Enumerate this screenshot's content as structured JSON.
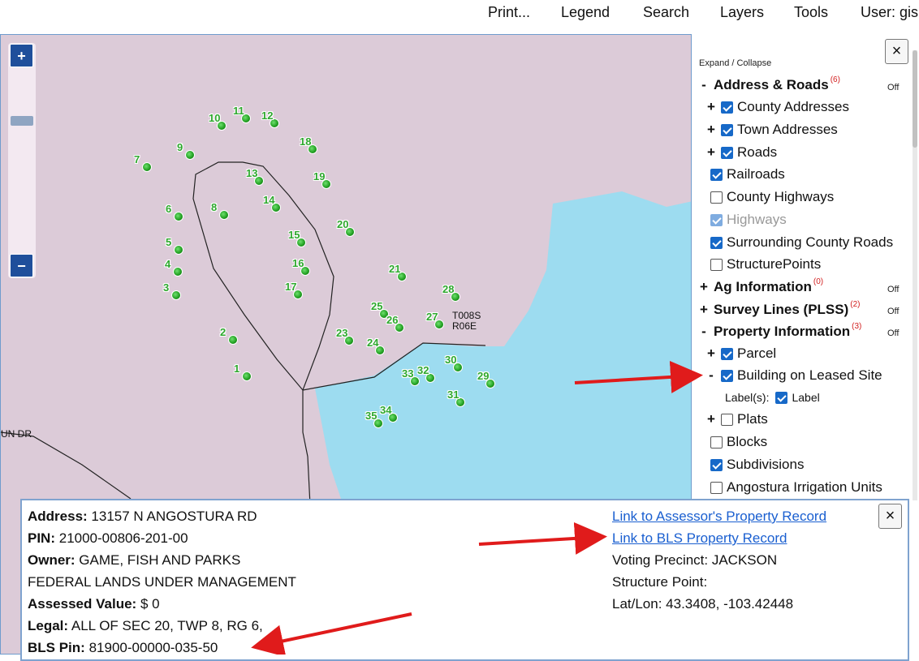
{
  "menu": {
    "items": [
      "Print...",
      "Legend",
      "Search",
      "Layers",
      "Tools"
    ],
    "user": "User: gis"
  },
  "map": {
    "zoom_in": "+",
    "zoom_out": "−",
    "road_label": "UN DR",
    "plss_label_line1": "T008S",
    "plss_label_line2": "R06E",
    "points": [
      "1",
      "2",
      "3",
      "4",
      "5",
      "6",
      "7",
      "8",
      "9",
      "10",
      "11",
      "12",
      "13",
      "14",
      "15",
      "16",
      "17",
      "18",
      "19",
      "20",
      "21",
      "23",
      "24",
      "25",
      "26",
      "27",
      "28",
      "29",
      "30",
      "31",
      "32",
      "33",
      "34",
      "35"
    ]
  },
  "layers": {
    "close": "×",
    "expand_collapse": "Expand / Collapse",
    "off": "Off",
    "groups": {
      "address": {
        "toggle": "-",
        "title": "Address & Roads",
        "count": "(6)"
      },
      "ag": {
        "toggle": "+",
        "title": "Ag Information",
        "count": "(0)"
      },
      "survey": {
        "toggle": "+",
        "title": "Survey Lines (PLSS)",
        "count": "(2)"
      },
      "property": {
        "toggle": "-",
        "title": "Property Information",
        "count": "(3)"
      }
    },
    "items": {
      "county_addresses": "County Addresses",
      "town_addresses": "Town Addresses",
      "roads": "Roads",
      "railroads": "Railroads",
      "county_highways": "County Highways",
      "highways": "Highways",
      "surrounding_roads": "Surrounding County Roads",
      "structure_points": "StructurePoints",
      "parcel": "Parcel",
      "building_leased": "Building on Leased Site",
      "labels_prefix": "Label(s):",
      "label": "Label",
      "plats": "Plats",
      "blocks": "Blocks",
      "subdivisions": "Subdivisions",
      "angostura": "Angostura Irrigation Units"
    },
    "toggles": {
      "plus": "+",
      "minus": "-"
    }
  },
  "popup": {
    "close": "×",
    "address_label": "Address:",
    "address": "13157 N ANGOSTURA RD",
    "pin_label": "PIN:",
    "pin": "21000-00806-201-00",
    "owner_label": "Owner:",
    "owner": "GAME, FISH AND PARKS",
    "owner2": "FEDERAL LANDS UNDER MANAGEMENT",
    "assessed_label": "Assessed Value:",
    "assessed": "$ 0",
    "legal_label": "Legal:",
    "legal": "ALL OF SEC 20, TWP 8, RG 6,",
    "bls_label": "BLS Pin:",
    "bls": "81900-00000-035-50",
    "assessor_link": "Link to Assessor's Property Record",
    "bls_link": "Link to BLS Property Record",
    "voting": "Voting Precinct: JACKSON",
    "structure": "Structure Point:",
    "latlon": "Lat/Lon: 43.3408, -103.42448"
  },
  "colors": {
    "map_bg": "#dccbd8",
    "water": "#9ddcf0",
    "point_green": "#2ea82e",
    "accent_blue": "#1f4f9b",
    "arrow_red": "#e01b1b",
    "link_blue": "#1a5fd0"
  }
}
